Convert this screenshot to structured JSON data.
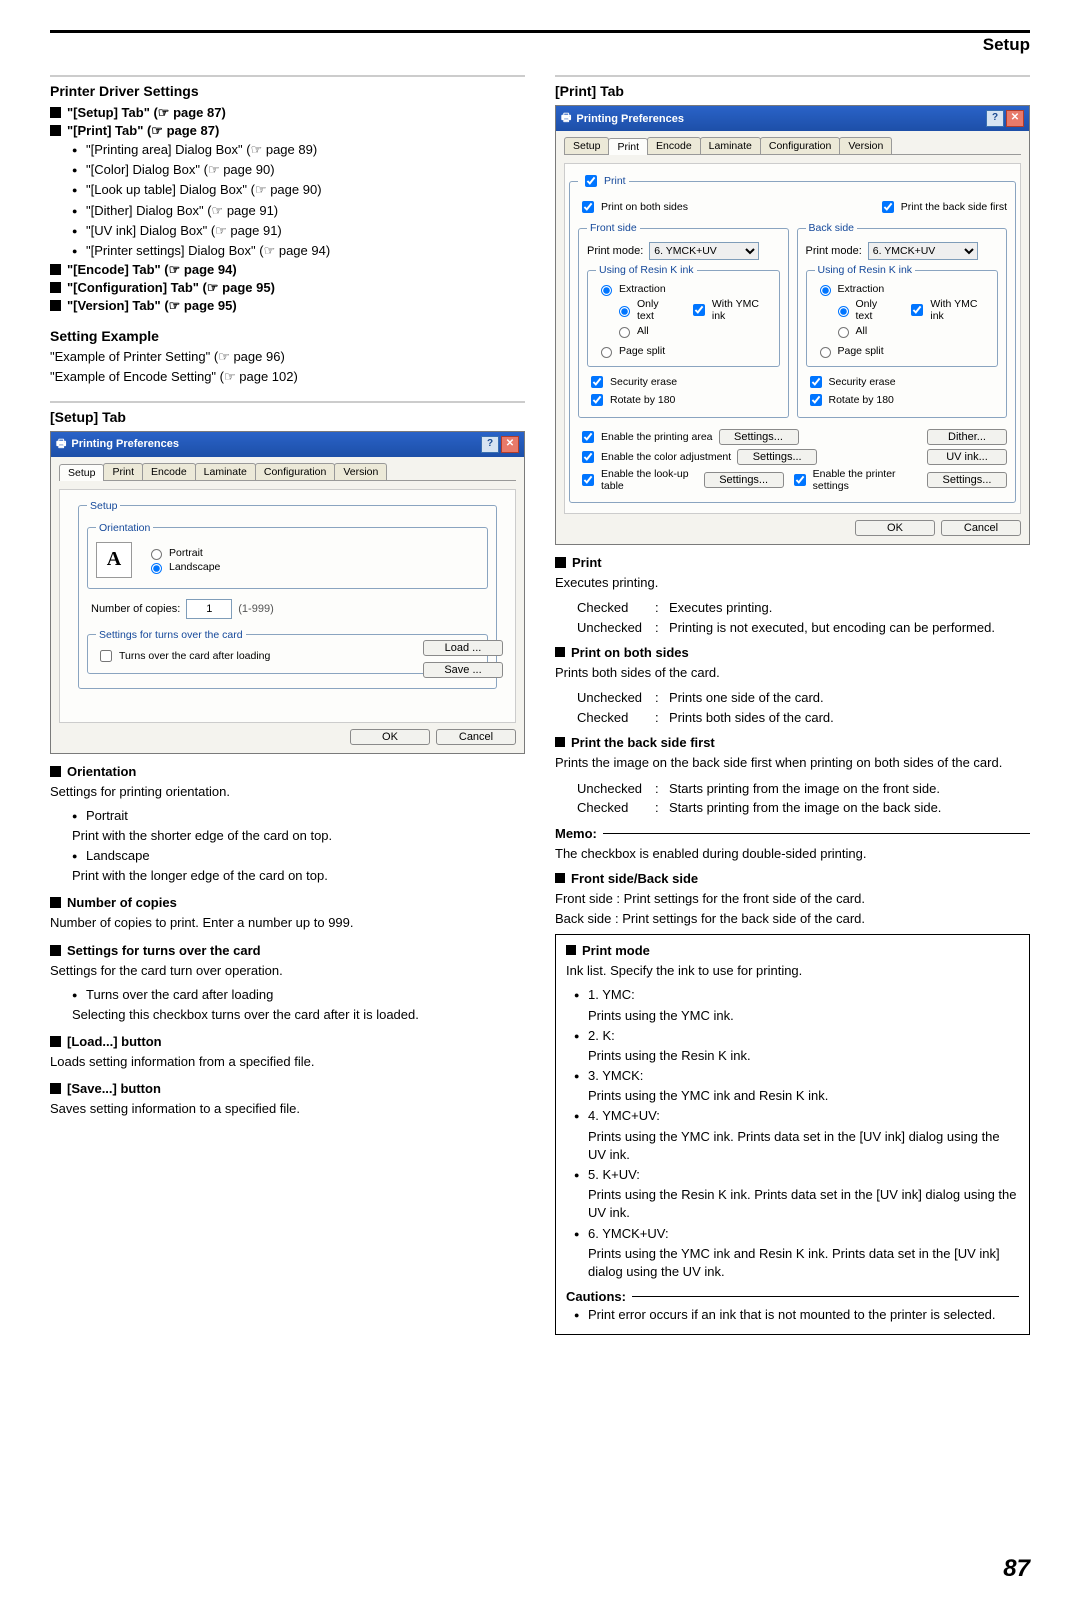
{
  "header": {
    "title": "Setup"
  },
  "page_number": "87",
  "left": {
    "h1": "Printer Driver Settings",
    "refs": {
      "setup_tab": "\"[Setup] Tab\" (☞ page 87)",
      "print_tab": "\"[Print] Tab\" (☞ page 87)",
      "printing_area": "\"[Printing area] Dialog Box\" (☞ page 89)",
      "color": "\"[Color] Dialog Box\" (☞ page 90)",
      "lookup": "\"[Look up table] Dialog Box\" (☞ page 90)",
      "dither": "\"[Dither] Dialog Box\" (☞ page 91)",
      "uvink": "\"[UV ink] Dialog Box\" (☞ page 91)",
      "printer_settings": "\"[Printer settings] Dialog Box\" (☞ page 94)",
      "encode_tab": "\"[Encode] Tab\" (☞ page 94)",
      "config_tab": "\"[Configuration] Tab\" (☞ page 95)",
      "version_tab": "\"[Version] Tab\" (☞ page 95)"
    },
    "setting_example": {
      "heading": "Setting Example",
      "l1": "\"Example of Printer Setting\" (☞ page 96)",
      "l2": "\"Example of Encode Setting\" (☞ page 102)"
    },
    "setup_tab_h": "[Setup] Tab",
    "setup_dialog": {
      "title": "Printing Preferences",
      "tabs": [
        "Setup",
        "Print",
        "Encode",
        "Laminate",
        "Configuration",
        "Version"
      ],
      "orientation_legend": "Orientation",
      "portrait": "Portrait",
      "landscape": "Landscape",
      "copies_label": "Number of copies:",
      "copies_value": "1",
      "copies_range": "(1-999)",
      "turns_legend": "Settings for turns over the card",
      "turns_label": "Turns over the card after loading",
      "load_btn": "Load ...",
      "save_btn": "Save ...",
      "ok": "OK",
      "cancel": "Cancel"
    },
    "orientation": {
      "h": "Orientation",
      "desc": "Settings for printing orientation.",
      "portrait_b": "Portrait",
      "portrait_d": "Print with the shorter edge of the card on top.",
      "landscape_b": "Landscape",
      "landscape_d": "Print with the longer edge of the card on top."
    },
    "copies": {
      "h": "Number of copies",
      "desc": "Number of copies to print. Enter a number up to 999."
    },
    "turns": {
      "h": "Settings for turns over the card",
      "desc": "Settings for the card turn over operation.",
      "b": "Turns over the card after loading",
      "d": "Selecting this checkbox turns over the card after it is loaded."
    },
    "load": {
      "h": "[Load...] button",
      "d": "Loads setting information from a specified file."
    },
    "save": {
      "h": "[Save...] button",
      "d": "Saves setting information to a specified file."
    }
  },
  "right": {
    "h1": "[Print] Tab",
    "print_dialog": {
      "title": "Printing Preferences",
      "tabs": [
        "Setup",
        "Print",
        "Encode",
        "Laminate",
        "Configuration",
        "Version"
      ],
      "print_legend": "Print",
      "both_sides": "Print on both sides",
      "back_first": "Print the back side first",
      "front_legend": "Front side",
      "back_legend": "Back side",
      "print_mode_label": "Print mode:",
      "print_mode_value": "6. YMCK+UV",
      "resin_legend": "Using of Resin K ink",
      "extraction": "Extraction",
      "only_text": "Only text",
      "with_ymc": "With YMC ink",
      "all": "All",
      "page_split": "Page split",
      "security": "Security erase",
      "rotate": "Rotate by 180",
      "en_area": "Enable the printing area",
      "en_color": "Enable the color adjustment",
      "en_lookup": "Enable the look-up table",
      "en_printer": "Enable the printer settings",
      "settings_btn": "Settings...",
      "dither_btn": "Dither...",
      "uv_btn": "UV ink...",
      "ok": "OK",
      "cancel": "Cancel"
    },
    "print_h": "Print",
    "print_desc": "Executes printing.",
    "print_checked": {
      "k": "Checked",
      "sep": ":",
      "v": "Executes printing."
    },
    "print_unchecked": {
      "k": "Unchecked",
      "sep": ":",
      "v": "Printing is not executed, but encoding can be performed."
    },
    "both_h": "Print on both sides",
    "both_d": "Prints both sides of the card.",
    "both_u": {
      "k": "Unchecked",
      "sep": ":",
      "v": "Prints one side of the card."
    },
    "both_c": {
      "k": "Checked",
      "sep": ":",
      "v": "Prints both sides of the card."
    },
    "backfirst_h": "Print the back side first",
    "backfirst_d": "Prints the image on the back side first when printing on both sides of the card.",
    "backfirst_u": {
      "k": "Unchecked",
      "sep": ":",
      "v": "Starts printing from the image on the front side."
    },
    "backfirst_c": {
      "k": "Checked",
      "sep": ":",
      "v": "Starts printing from the image on the back side."
    },
    "memo_label": "Memo:",
    "memo_text": "The checkbox is enabled during double-sided printing.",
    "fsbs_h": "Front side/Back side",
    "fsbs_1": "Front side : Print settings for the front side of the card.",
    "fsbs_2": "Back side : Print settings for the back side of the card.",
    "printmode": {
      "h": "Print mode",
      "desc": "Ink list. Specify the ink to use for printing.",
      "m1a": "1. YMC:",
      "m1b": "Prints using the YMC ink.",
      "m2a": "2. K:",
      "m2b": "Prints using the Resin K ink.",
      "m3a": "3. YMCK:",
      "m3b": "Prints using the YMC ink and Resin K ink.",
      "m4a": "4. YMC+UV:",
      "m4b": "Prints using the YMC ink. Prints data set in the [UV ink] dialog using the UV ink.",
      "m5a": "5. K+UV:",
      "m5b": "Prints using the Resin K ink. Prints data set in the [UV ink] dialog using the UV ink.",
      "m6a": "6. YMCK+UV:",
      "m6b": "Prints using the YMC ink and Resin K ink. Prints data set in the [UV ink] dialog using the UV ink."
    },
    "cautions_label": "Cautions:",
    "cautions_text": "Print error occurs if an ink that is not mounted to the printer is selected."
  }
}
